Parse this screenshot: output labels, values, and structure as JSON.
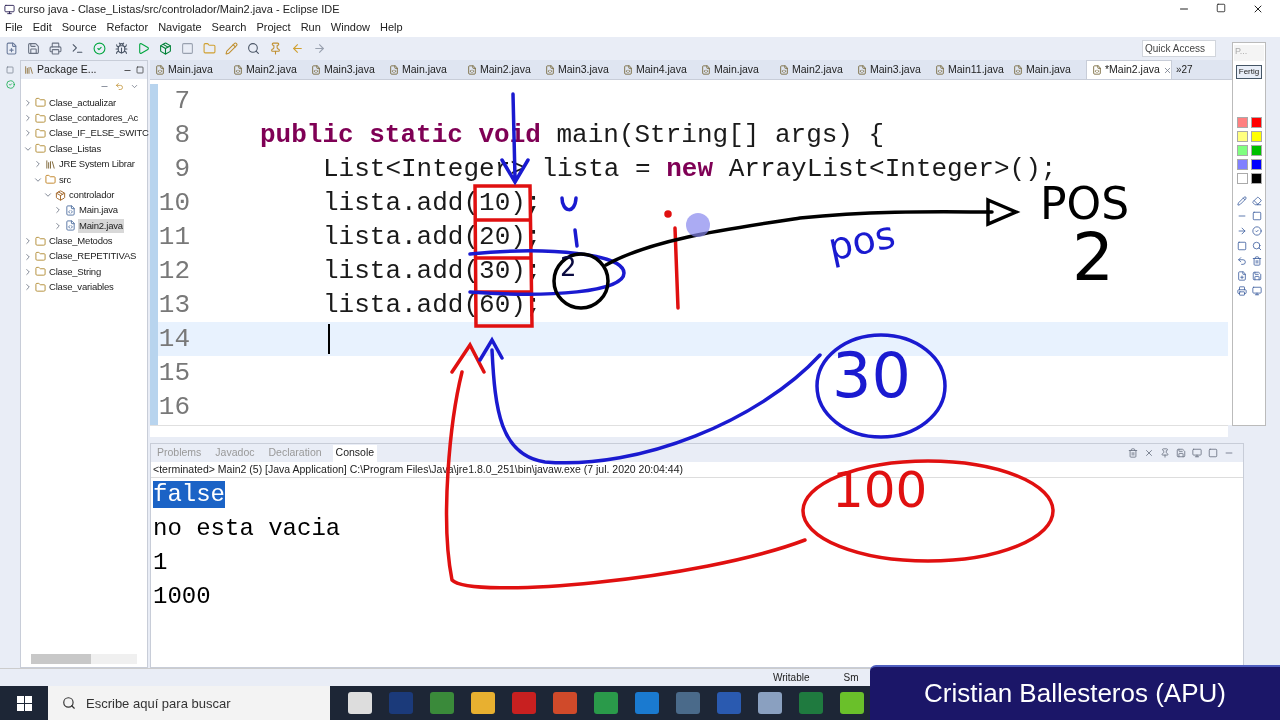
{
  "window": {
    "title": "curso java - Clase_Listas/src/controlador/Main2.java - Eclipse IDE"
  },
  "menu": [
    "File",
    "Edit",
    "Source",
    "Refactor",
    "Navigate",
    "Search",
    "Project",
    "Run",
    "Window",
    "Help"
  ],
  "quick_access": {
    "placeholder": "Quick Access"
  },
  "package_explorer": {
    "title": "Package E...",
    "items": [
      {
        "label": "Clase_actualizar",
        "kind": "project",
        "expanded": false,
        "selected": false
      },
      {
        "label": "Clase_contadores_Ac",
        "kind": "project",
        "expanded": false,
        "selected": false
      },
      {
        "label": "Clase_IF_ELSE_SWITC",
        "kind": "project",
        "expanded": false,
        "selected": false
      },
      {
        "label": "Clase_Listas",
        "kind": "project",
        "expanded": true,
        "selected": false,
        "children": [
          {
            "label": "JRE System Librar",
            "kind": "library",
            "expanded": false,
            "selected": false
          },
          {
            "label": "src",
            "kind": "folder",
            "expanded": true,
            "selected": false,
            "children": [
              {
                "label": "controlador",
                "kind": "package",
                "expanded": true,
                "selected": false,
                "children": [
                  {
                    "label": "Main.java",
                    "kind": "file",
                    "expanded": false,
                    "selected": false
                  },
                  {
                    "label": "Main2.java",
                    "kind": "file",
                    "expanded": false,
                    "selected": true
                  }
                ]
              }
            ]
          }
        ]
      },
      {
        "label": "Clase_Metodos",
        "kind": "project",
        "expanded": false,
        "selected": false
      },
      {
        "label": "Clase_REPETITIVAS",
        "kind": "project",
        "expanded": false,
        "selected": false
      },
      {
        "label": "Clase_String",
        "kind": "project",
        "expanded": false,
        "selected": false
      },
      {
        "label": "Clase_variables",
        "kind": "project",
        "expanded": false,
        "selected": false
      }
    ]
  },
  "editor_tabs": [
    {
      "label": "Main.java",
      "selected": false
    },
    {
      "label": "Main2.java",
      "selected": false
    },
    {
      "label": "Main3.java",
      "selected": false
    },
    {
      "label": "Main.java",
      "selected": false
    },
    {
      "label": "Main2.java",
      "selected": false
    },
    {
      "label": "Main3.java",
      "selected": false
    },
    {
      "label": "Main4.java",
      "selected": false
    },
    {
      "label": "Main.java",
      "selected": false
    },
    {
      "label": "Main2.java",
      "selected": false
    },
    {
      "label": "Main3.java",
      "selected": false
    },
    {
      "label": "Main11.java",
      "selected": false
    },
    {
      "label": "Main.java",
      "selected": false
    },
    {
      "label": "*Main2.java",
      "selected": true
    }
  ],
  "tabs_overflow": "»27",
  "code": [
    {
      "number": "7",
      "current": false
    },
    {
      "number": "8",
      "current": false,
      "kind": "signature",
      "tokens": [
        {
          "kind": "keyword",
          "text": "public"
        },
        {
          "kind": "keyword",
          "text": "static"
        },
        {
          "kind": "keyword",
          "text": "void"
        },
        {
          "kind": "plain",
          "text": "main(String[] args) {"
        }
      ]
    },
    {
      "number": "9",
      "current": false,
      "kind": "statement",
      "tokens": [
        {
          "kind": "plain",
          "text": "List<Integer> lista ="
        },
        {
          "kind": "keyword",
          "text": "new"
        },
        {
          "kind": "plain",
          "text": "ArrayList<Integer>();"
        }
      ]
    },
    {
      "number": "10",
      "current": false,
      "kind": "statement",
      "tokens": [
        {
          "kind": "plain",
          "text": "lista.add(10);"
        }
      ]
    },
    {
      "number": "11",
      "current": false,
      "kind": "statement",
      "tokens": [
        {
          "kind": "plain",
          "text": "lista.add(20);"
        }
      ]
    },
    {
      "number": "12",
      "current": false,
      "kind": "statement",
      "tokens": [
        {
          "kind": "plain",
          "text": "lista.add(30);"
        }
      ]
    },
    {
      "number": "13",
      "current": false,
      "kind": "statement",
      "tokens": [
        {
          "kind": "plain",
          "text": "lista.add(60);"
        }
      ]
    },
    {
      "number": "14",
      "current": true
    },
    {
      "number": "15",
      "current": false
    },
    {
      "number": "16",
      "current": false
    }
  ],
  "console_tabs": [
    {
      "label": "Problems",
      "selected": false
    },
    {
      "label": "Javadoc",
      "selected": false
    },
    {
      "label": "Declaration",
      "selected": false
    },
    {
      "label": "Console",
      "selected": true
    }
  ],
  "console": {
    "header": "<terminated> Main2 (5) [Java Application] C:\\Program Files\\Java\\jre1.8.0_251\\bin\\javaw.exe (7 jul. 2020 20:04:44)",
    "lines": [
      {
        "text": "false",
        "selected": true
      },
      {
        "text": "no esta vacia",
        "selected": false
      },
      {
        "text": "1",
        "selected": false
      },
      {
        "text": "1000",
        "selected": false
      }
    ]
  },
  "palette": {
    "field": "P...",
    "button": "Fertig",
    "swatches": [
      {
        "color": "#ff8080"
      },
      {
        "color": "#ff0000"
      },
      {
        "color": "#ffff80"
      },
      {
        "color": "#ffff00"
      },
      {
        "color": "#80ff80"
      },
      {
        "color": "#00c000"
      },
      {
        "color": "#8080ff"
      },
      {
        "color": "#0000ff"
      },
      {
        "color": "#ffffff"
      },
      {
        "color": "#000000"
      }
    ]
  },
  "status_bar": [
    "Writable",
    "Sm"
  ],
  "taskbar": {
    "search": {
      "placeholder": "Escribe aquí para buscar"
    }
  },
  "handwriting": [
    {
      "text": "POS",
      "color": "#000000"
    },
    {
      "text": "2",
      "color": "#000000"
    },
    {
      "text": "pos",
      "color": "#1a1ad0"
    },
    {
      "text": "30",
      "color": "#1a1ad0"
    },
    {
      "text": "100",
      "color": "#e01010"
    },
    {
      "text": "2",
      "color": "#0a0a40"
    }
  ],
  "caption": "Cristian Ballesteros (APU)"
}
